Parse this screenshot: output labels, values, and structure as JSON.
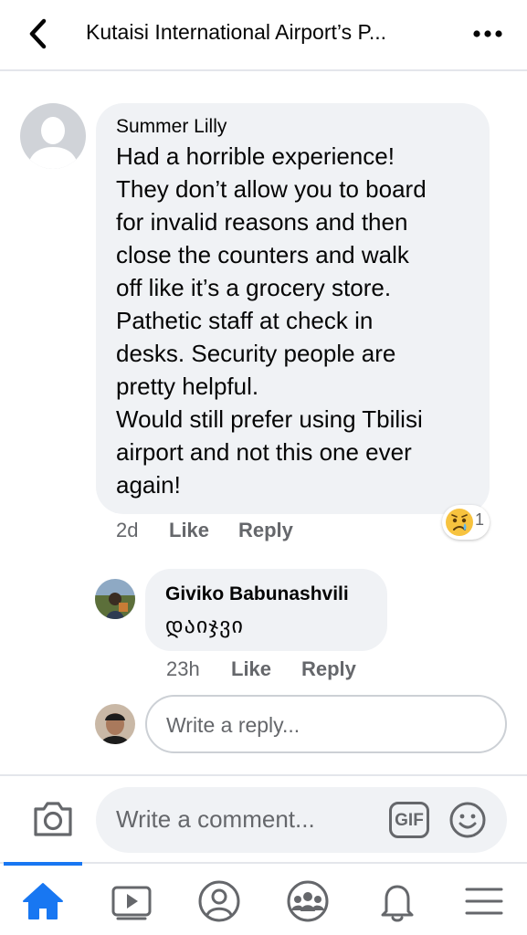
{
  "header": {
    "title": "Kutaisi International Airport’s P...",
    "back_icon": "chevron-left-icon",
    "more_icon": "more-horizontal-icon"
  },
  "comment": {
    "author": "Summer Lilly",
    "text_lines": [
      "Had a horrible experience!",
      "They don’t allow you to board",
      "for invalid reasons and then",
      "close the counters and walk",
      "off like it’s a grocery store.",
      "Pathetic staff at check in",
      "desks. Security people are",
      "pretty helpful.",
      "Would still prefer using Tbilisi",
      "airport and not this one ever",
      "again!"
    ],
    "time": "2d",
    "like_label": "Like",
    "reply_label": "Reply",
    "reaction": {
      "emoji": "sad-face-emoji",
      "count": "1"
    }
  },
  "reply": {
    "author": "Giviko Babunashvili",
    "text": "დაიჯვი",
    "time": "23h",
    "like_label": "Like",
    "reply_label": "Reply"
  },
  "reply_input": {
    "placeholder": "Write a reply..."
  },
  "comment_bar": {
    "placeholder": "Write a comment...",
    "gif_label": "GIF"
  },
  "tabs": [
    "home-icon",
    "watch-icon",
    "profile-icon",
    "groups-icon",
    "notifications-icon",
    "menu-icon"
  ],
  "colors": {
    "accent": "#1877f2",
    "bubble": "#f0f2f5",
    "secondary_text": "#65676b"
  }
}
